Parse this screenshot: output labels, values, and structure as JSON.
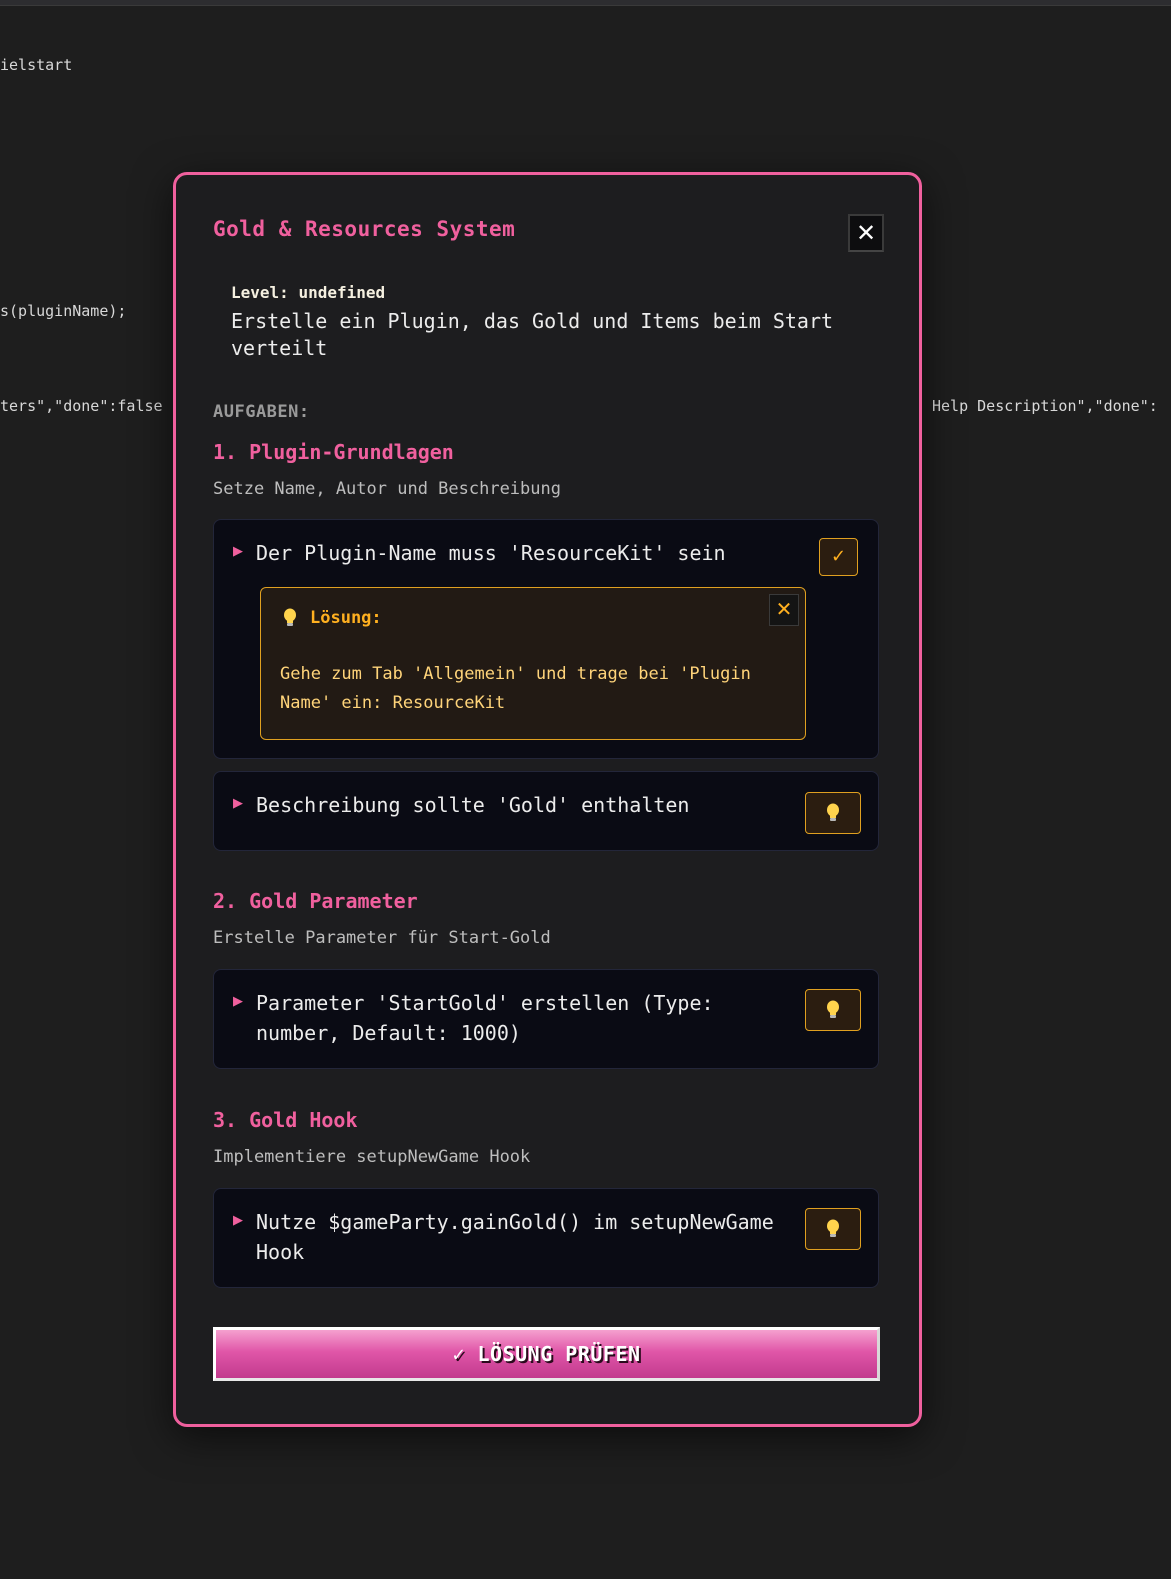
{
  "background_code": {
    "line1": "ielstart",
    "line2": "s(pluginName);",
    "line3": "ters\",\"done\":false",
    "line4": "Help Description\",\"done\":"
  },
  "modal": {
    "title": "Gold & Resources System",
    "close_label": "✕",
    "level_label": "Level:",
    "level_value": "undefined",
    "description": "Erstelle ein Plugin, das Gold und Items beim Start verteilt",
    "tasks_label": "AUFGABEN:",
    "sections": [
      {
        "title": "1. Plugin-Grundlagen",
        "subtitle": "Setze Name, Autor und Beschreibung",
        "tasks": [
          {
            "text": "Der Plugin-Name muss 'ResourceKit' sein",
            "done": true,
            "check_label": "✓",
            "solution": {
              "label": "Lösung:",
              "text": "Gehe zum Tab 'Allgemein' und trage bei 'Plugin Name' ein: ResourceKit",
              "close_label": "✕"
            }
          },
          {
            "text": "Beschreibung sollte 'Gold' enthalten",
            "done": false,
            "hint_icon": "lightbulb-icon"
          }
        ]
      },
      {
        "title": "2. Gold Parameter",
        "subtitle": "Erstelle Parameter für Start-Gold",
        "tasks": [
          {
            "text": "Parameter 'StartGold' erstellen (Type: number, Default: 1000)",
            "done": false,
            "hint_icon": "lightbulb-icon"
          }
        ]
      },
      {
        "title": "3. Gold Hook",
        "subtitle": "Implementiere setupNewGame Hook",
        "tasks": [
          {
            "text": "Nutze $gameParty.gainGold() im setupNewGame Hook",
            "done": false,
            "hint_icon": "lightbulb-icon"
          }
        ]
      }
    ],
    "submit_label": "✓ LÖSUNG PRÜFEN"
  },
  "colors": {
    "accent": "#f0609e",
    "hint_border": "#e0a020",
    "solution_text": "#ffd47a",
    "background": "#1e1e1e",
    "card_bg": "#0a0b14"
  }
}
